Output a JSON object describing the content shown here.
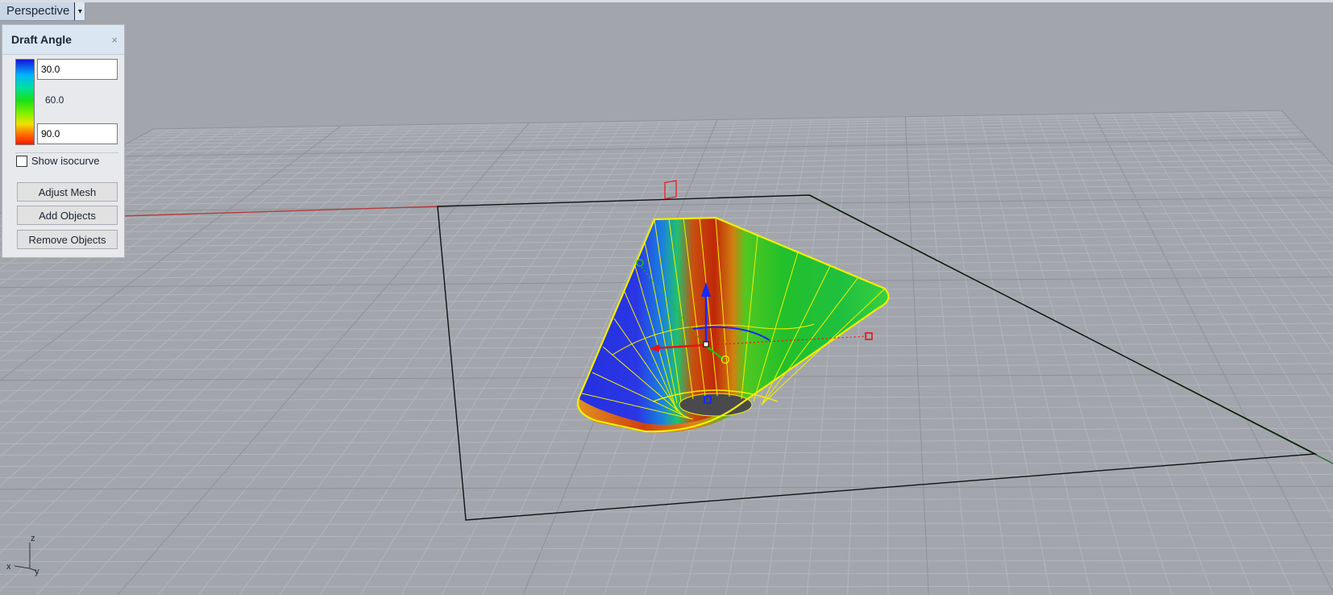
{
  "viewport": {
    "title": "Perspective",
    "dropdown_glyph": "▾"
  },
  "panel": {
    "title": "Draft Angle",
    "close_glyph": "×",
    "min_value": "30.0",
    "mid_value": "60.0",
    "max_value": "90.0",
    "show_isocurve_label": "Show isocurve",
    "show_isocurve_checked": false,
    "buttons": {
      "adjust_mesh": "Adjust Mesh",
      "add_objects": "Add Objects",
      "remove_objects": "Remove Objects"
    }
  },
  "axes_widget": {
    "z": "z",
    "x": "x",
    "y": "y"
  },
  "colors": {
    "viewport_bg": "#a2a6ac",
    "grid_line": "#b2b6bc",
    "x_axis": "#b43c3c",
    "y_axis": "#2a6e2a",
    "selection": "#f2f000",
    "gumball_x": "#e81414",
    "gumball_y": "#18c018",
    "gumball_z": "#1428ff"
  }
}
